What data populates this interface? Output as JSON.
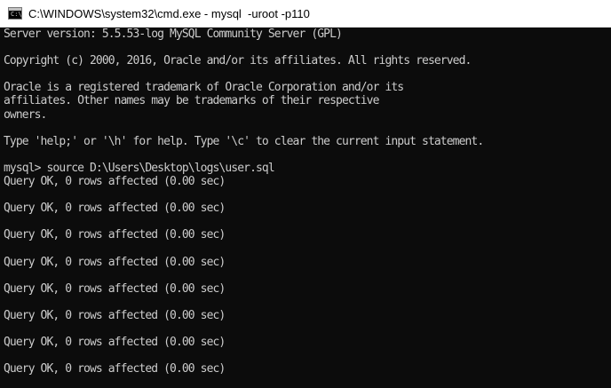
{
  "window": {
    "title": "C:\\WINDOWS\\system32\\cmd.exe - mysql  -uroot -p110",
    "icon": "cmd-icon"
  },
  "console": {
    "lines": [
      "Server version: 5.5.53-log MySQL Community Server (GPL)",
      "",
      "Copyright (c) 2000, 2016, Oracle and/or its affiliates. All rights reserved.",
      "",
      "Oracle is a registered trademark of Oracle Corporation and/or its",
      "affiliates. Other names may be trademarks of their respective",
      "owners.",
      "",
      "Type 'help;' or '\\h' for help. Type '\\c' to clear the current input statement.",
      "",
      "mysql> source D:\\Users\\Desktop\\logs\\user.sql",
      "Query OK, 0 rows affected (0.00 sec)",
      "",
      "Query OK, 0 rows affected (0.00 sec)",
      "",
      "Query OK, 0 rows affected (0.00 sec)",
      "",
      "Query OK, 0 rows affected (0.00 sec)",
      "",
      "Query OK, 0 rows affected (0.00 sec)",
      "",
      "Query OK, 0 rows affected (0.00 sec)",
      "",
      "Query OK, 0 rows affected (0.00 sec)",
      "",
      "Query OK, 0 rows affected (0.00 sec)"
    ]
  },
  "colors": {
    "console_background": "#0c0c0c",
    "console_text": "#cccccc",
    "titlebar_background": "#ffffff"
  }
}
